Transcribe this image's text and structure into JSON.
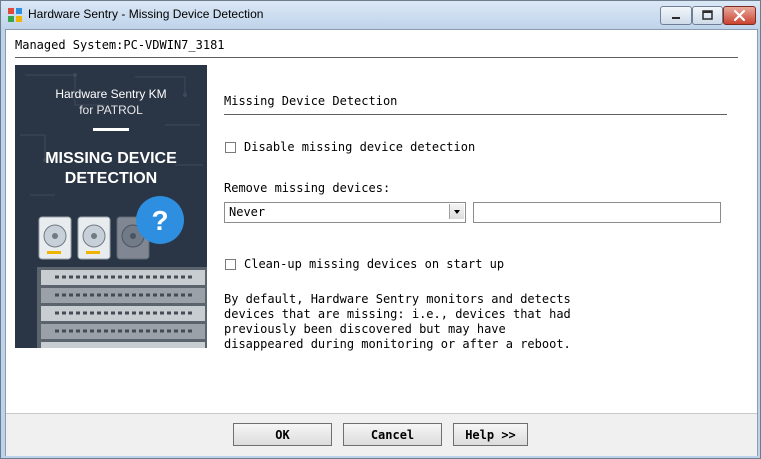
{
  "window": {
    "title": "Hardware Sentry - Missing Device Detection"
  },
  "header": {
    "managed_system": "Managed System:PC-VDWIN7_3181"
  },
  "promo": {
    "brand_line1": "Hardware Sentry KM",
    "brand_line2": "for PATROL",
    "headline_line1": "MISSING DEVICE",
    "headline_line2": "DETECTION"
  },
  "section": {
    "title": "Missing Device Detection"
  },
  "options": {
    "disable_label": "Disable missing device detection",
    "disable_checked": false,
    "remove_label": "Remove missing devices:",
    "remove_selected": "Never",
    "remove_value": "",
    "cleanup_label": "Clean-up missing devices on start up",
    "cleanup_checked": false
  },
  "description": {
    "lines": [
      "By default, Hardware Sentry monitors and detects",
      "devices that are missing: i.e., devices that had",
      "previously been discovered but may have",
      "disappeared during monitoring or after a reboot."
    ]
  },
  "buttons": {
    "ok": "OK",
    "cancel": "Cancel",
    "help": "Help >>"
  },
  "colors": {
    "titlebar": "#bed3ea",
    "close_button": "#c9432f",
    "promo_background": "#2a3545",
    "help_badge": "#2e8fe0"
  }
}
